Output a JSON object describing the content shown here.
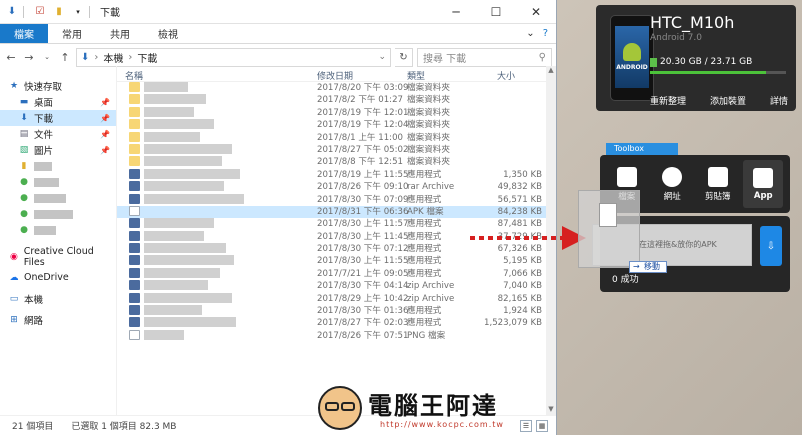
{
  "explorer": {
    "title": "下載",
    "ribbon_tabs": [
      "檔案",
      "常用",
      "共用",
      "檢視"
    ],
    "address_parts": [
      "本機",
      "下載"
    ],
    "search_placeholder": "搜尋 下載",
    "columns": {
      "name": "名稱",
      "date": "修改日期",
      "type": "類型",
      "size": "大小"
    },
    "nav": [
      {
        "label": "快速存取",
        "icon": "star-icon",
        "pinned": false,
        "selected": false,
        "sub": false
      },
      {
        "label": "桌面",
        "icon": "desktop-icon",
        "pinned": true,
        "selected": false,
        "sub": true
      },
      {
        "label": "下載",
        "icon": "download-icon",
        "pinned": true,
        "selected": true,
        "sub": true
      },
      {
        "label": "文件",
        "icon": "document-icon",
        "pinned": true,
        "selected": false,
        "sub": true
      },
      {
        "label": "圖片",
        "icon": "picture-icon",
        "pinned": true,
        "selected": false,
        "sub": true
      }
    ],
    "nav_bottom": [
      {
        "label": "Creative Cloud Files",
        "icon": "creative-cloud-icon"
      },
      {
        "label": "OneDrive",
        "icon": "onedrive-icon"
      },
      {
        "label": "本機",
        "icon": "computer-icon"
      },
      {
        "label": "網路",
        "icon": "network-icon"
      }
    ],
    "files": [
      {
        "date": "2017/8/20 下午 03:09",
        "type": "檔案資料夾",
        "size": "",
        "icon": "folder"
      },
      {
        "date": "2017/8/2 下午 01:27",
        "type": "檔案資料夾",
        "size": "",
        "icon": "folder"
      },
      {
        "date": "2017/8/19 下午 12:01",
        "type": "檔案資料夾",
        "size": "",
        "icon": "folder"
      },
      {
        "date": "2017/8/19 下午 12:04",
        "type": "檔案資料夾",
        "size": "",
        "icon": "folder"
      },
      {
        "date": "2017/8/1 上午 11:00",
        "type": "檔案資料夾",
        "size": "",
        "icon": "folder"
      },
      {
        "date": "2017/8/27 下午 05:02",
        "type": "檔案資料夾",
        "size": "",
        "icon": "folder"
      },
      {
        "date": "2017/8/8 下午 12:51",
        "type": "檔案資料夾",
        "size": "",
        "icon": "folder"
      },
      {
        "date": "2017/8/19 上午 11:55",
        "type": "應用程式",
        "size": "1,350 KB",
        "icon": "app"
      },
      {
        "date": "2017/8/26 下午 09:10",
        "type": "rar Archive",
        "size": "49,832 KB",
        "icon": "app"
      },
      {
        "date": "2017/8/30 下午 07:09",
        "type": "應用程式",
        "size": "56,571 KB",
        "icon": "app"
      },
      {
        "date": "2017/8/31 下午 06:36",
        "type": "APK 檔案",
        "size": "84,238 KB",
        "icon": "doc",
        "selected": true
      },
      {
        "date": "2017/8/30 上午 11:57",
        "type": "應用程式",
        "size": "87,481 KB",
        "icon": "app"
      },
      {
        "date": "2017/8/30 上午 11:45",
        "type": "應用程式",
        "size": "37,729 KB",
        "icon": "app"
      },
      {
        "date": "2017/8/30 下午 07:12",
        "type": "應用程式",
        "size": "67,326 KB",
        "icon": "app"
      },
      {
        "date": "2017/8/30 上午 11:55",
        "type": "應用程式",
        "size": "5,195 KB",
        "icon": "app"
      },
      {
        "date": "2017/7/21 上午 09:05",
        "type": "應用程式",
        "size": "7,066 KB",
        "icon": "app"
      },
      {
        "date": "2017/8/30 下午 04:14",
        "type": "zip Archive",
        "size": "7,040 KB",
        "icon": "app"
      },
      {
        "date": "2017/8/29 上午 10:42",
        "type": "zip Archive",
        "size": "82,165 KB",
        "icon": "app"
      },
      {
        "date": "2017/8/30 下午 01:36",
        "type": "應用程式",
        "size": "1,924 KB",
        "icon": "app"
      },
      {
        "date": "2017/8/27 下午 02:03",
        "type": "應用程式",
        "size": "1,523,079 KB",
        "icon": "app"
      },
      {
        "date": "2017/8/26 下午 07:51",
        "type": "PNG 檔案",
        "size": "",
        "icon": "doc"
      }
    ],
    "status": {
      "count": "21 個項目",
      "selected": "已選取 1 個項目 82.3 MB"
    }
  },
  "device": {
    "name": "HTC_M10h",
    "os": "Android 7.0",
    "storage_text": "20.30 GB / 23.71 GB",
    "storage_fraction": 0.856,
    "screen_label": "ANDROID",
    "actions": [
      "重新整理",
      "添加裝置",
      "詳情"
    ]
  },
  "toolbox": {
    "tab_label": "Toolbox",
    "tools": [
      {
        "label": "檔案",
        "icon": "file-icon",
        "active": false
      },
      {
        "label": "網址",
        "icon": "globe-icon",
        "active": false
      },
      {
        "label": "剪貼簿",
        "icon": "clipboard-icon",
        "active": false
      },
      {
        "label": "App",
        "icon": "app-icon",
        "active": true
      }
    ]
  },
  "drop": {
    "hint": "在這裡拖&放你的APK",
    "move_tip": "移動",
    "success": "0 成功"
  },
  "watermark": {
    "text": "電腦王阿達",
    "url": "http://www.kocpc.com.tw"
  },
  "colors": {
    "accent": "#1979ca",
    "storage": "#4cc23a",
    "arrow": "#d62020"
  }
}
